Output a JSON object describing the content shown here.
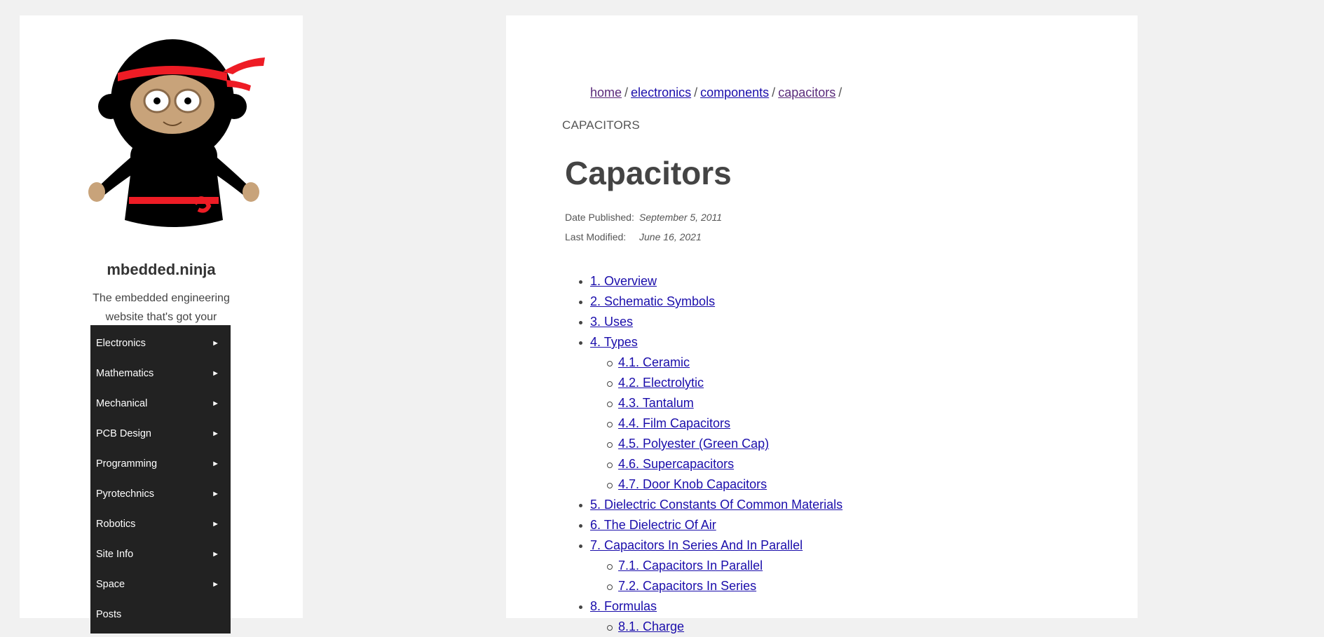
{
  "site": {
    "title": "mbedded.ninja",
    "tagline": "The embedded engineering website that's got your back."
  },
  "nav": {
    "items": [
      {
        "label": "Electronics"
      },
      {
        "label": "Mathematics"
      },
      {
        "label": "Mechanical"
      },
      {
        "label": "PCB Design"
      },
      {
        "label": "Programming"
      },
      {
        "label": "Pyrotechnics"
      },
      {
        "label": "Robotics"
      },
      {
        "label": "Site Info"
      },
      {
        "label": "Space"
      },
      {
        "label": "Posts"
      }
    ],
    "arrow": "►"
  },
  "breadcrumb": {
    "items": [
      "home",
      "electronics",
      "components",
      "capacitors"
    ],
    "separator": "/"
  },
  "page": {
    "category": "CAPACITORS",
    "title": "Capacitors",
    "date_published_label": "Date Published:",
    "date_published": "September 5, 2011",
    "last_modified_label": "Last Modified:",
    "last_modified": "June 16, 2021"
  },
  "toc": [
    {
      "level": 1,
      "label": "1. Overview"
    },
    {
      "level": 1,
      "label": "2. Schematic Symbols"
    },
    {
      "level": 1,
      "label": "3. Uses"
    },
    {
      "level": 1,
      "label": "4. Types"
    },
    {
      "level": 2,
      "label": "4.1. Ceramic"
    },
    {
      "level": 2,
      "label": "4.2. Electrolytic"
    },
    {
      "level": 2,
      "label": "4.3. Tantalum"
    },
    {
      "level": 2,
      "label": "4.4. Film Capacitors"
    },
    {
      "level": 2,
      "label": "4.5. Polyester (Green Cap)"
    },
    {
      "level": 2,
      "label": "4.6. Supercapacitors"
    },
    {
      "level": 2,
      "label": "4.7. Door Knob Capacitors"
    },
    {
      "level": 1,
      "label": "5. Dielectric Constants Of Common Materials"
    },
    {
      "level": 1,
      "label": "6. The Dielectric Of Air"
    },
    {
      "level": 1,
      "label": "7. Capacitors In Series And In Parallel"
    },
    {
      "level": 2,
      "label": "7.1. Capacitors In Parallel"
    },
    {
      "level": 2,
      "label": "7.2. Capacitors In Series"
    },
    {
      "level": 1,
      "label": "8. Formulas"
    },
    {
      "level": 2,
      "label": "8.1. Charge"
    }
  ],
  "colors": {
    "link": "#1a0dab",
    "visited_link": "#5a2a7a",
    "nav_bg": "#222222",
    "headband": "#ee1c25"
  }
}
